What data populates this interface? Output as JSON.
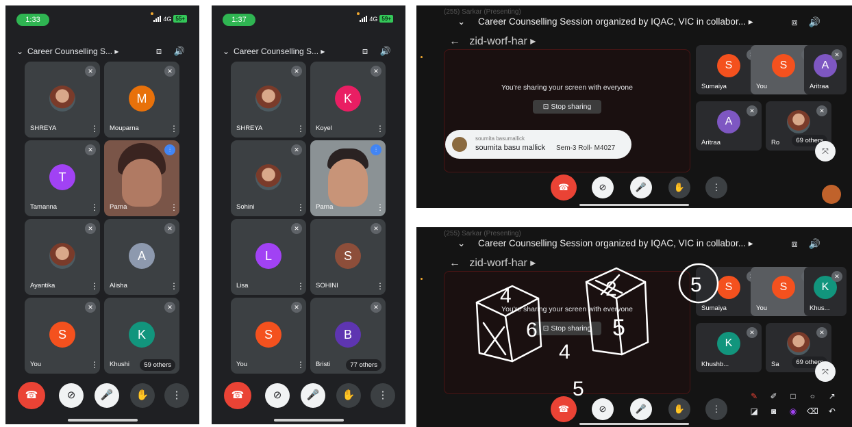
{
  "colors": {
    "end_call": "#ea4335",
    "status_green": "#2fb552",
    "avatar_orange_m": "#e8710a",
    "avatar_purple": "#a142f4",
    "avatar_grey": "#8d99ae",
    "avatar_orange_s": "#f4511e",
    "avatar_teal": "#12957d",
    "avatar_pink": "#e91e63",
    "avatar_brown": "#8d4e3a",
    "avatar_indigo": "#5e35b1",
    "avatar_purple2": "#7e57c2"
  },
  "screen1": {
    "time": "1:33",
    "network": "4G",
    "battery": "55+",
    "meeting_title": "Career Counselling S...",
    "tiles": [
      {
        "name": "SHREYA",
        "initial": "",
        "color": "",
        "photo": true
      },
      {
        "name": "Mouparna",
        "initial": "M",
        "color": "#e8710a"
      },
      {
        "name": "Tamanna",
        "initial": "T",
        "color": "#a142f4"
      },
      {
        "name": "Parna",
        "video": true
      },
      {
        "name": "Ayantika",
        "initial": "",
        "photo": true
      },
      {
        "name": "Alisha",
        "initial": "A",
        "color": "#8d99ae"
      },
      {
        "name": "You",
        "initial": "S",
        "color": "#f4511e"
      },
      {
        "name": "Khushi",
        "initial": "K",
        "color": "#12957d",
        "others": "59 others"
      }
    ]
  },
  "screen2": {
    "time": "1:37",
    "network": "4G",
    "battery": "59+",
    "meeting_title": "Career Counselling S...",
    "tiles": [
      {
        "name": "SHREYA",
        "photo": true
      },
      {
        "name": "Koyel",
        "initial": "K",
        "color": "#e91e63"
      },
      {
        "name": "Sohini",
        "photo": true
      },
      {
        "name": "Parna",
        "video": true
      },
      {
        "name": "Lisa",
        "initial": "L",
        "color": "#a142f4"
      },
      {
        "name": "SOHINI",
        "initial": "S",
        "color": "#8d4e3a"
      },
      {
        "name": "You",
        "initial": "S",
        "color": "#f4511e"
      },
      {
        "name": "Bristi",
        "initial": "B",
        "color": "#5e35b1",
        "others": "77 others"
      }
    ]
  },
  "screen3": {
    "ghost_text": "(255) Sarkar (Presenting)",
    "meeting_title": "Career Counselling Session organized by IQAC, VIC in collabor...",
    "meeting_code": "zid-worf-har",
    "sharing_message": "You're sharing your screen with everyone",
    "stop_sharing": "Stop sharing",
    "toast_small": "soumita basumallick",
    "toast_name": "soumita basu mallick",
    "toast_roll": "Sem-3 Roll- M4027",
    "tiles": [
      {
        "name": "Sumaiya",
        "initial": "S",
        "color": "#f4511e"
      },
      {
        "name": "You",
        "initial": "S",
        "color": "#f4511e",
        "selected": true
      },
      {
        "name": "Aritraa",
        "initial": "A",
        "color": "#7e57c2"
      },
      {
        "name": "Aritraa",
        "initial": "A",
        "color": "#7e57c2"
      },
      {
        "name": "Ro",
        "photo": true,
        "others": "69 others"
      }
    ]
  },
  "screen4": {
    "ghost_text": "(255) Sarkar (Presenting)",
    "meeting_title": "Career Counselling Session organized by IQAC, VIC in collabor...",
    "meeting_code": "zid-worf-har",
    "sharing_message": "You're sharing your screen with everyone",
    "stop_sharing": "Stop sharing",
    "tiles": [
      {
        "name": "Sumaiya",
        "initial": "S",
        "color": "#f4511e"
      },
      {
        "name": "You",
        "initial": "S",
        "color": "#f4511e",
        "selected": true
      },
      {
        "name": "Khus...",
        "initial": "K",
        "color": "#12957d"
      },
      {
        "name": "Khushb...",
        "initial": "K",
        "color": "#12957d"
      },
      {
        "name": "Sa",
        "photo": true,
        "others": "69 others"
      }
    ],
    "drawn_digits": [
      "4",
      "2",
      "5",
      "6",
      "5",
      "4",
      "5"
    ]
  }
}
